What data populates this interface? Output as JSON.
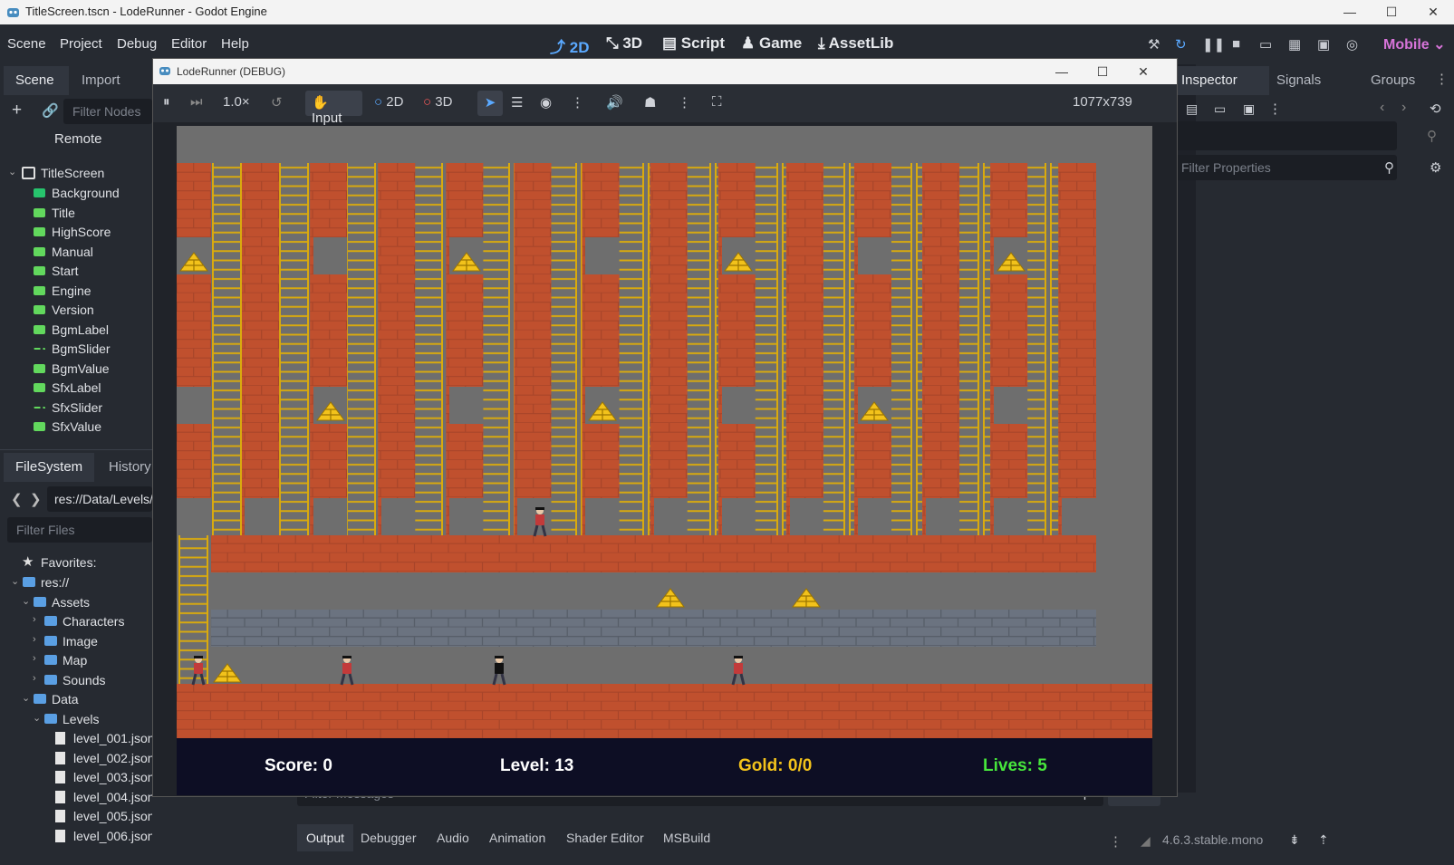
{
  "os_window": {
    "title": "TitleScreen.tscn - LodeRunner - Godot Engine",
    "minimize": "—",
    "maximize": "☐",
    "close": "✕"
  },
  "menu": [
    "Scene",
    "Project",
    "Debug",
    "Editor",
    "Help"
  ],
  "modes": [
    {
      "icon": "⤴",
      "label": "2D"
    },
    {
      "icon": "⤡",
      "label": "3D"
    },
    {
      "icon": "▤",
      "label": "Script"
    },
    {
      "icon": "♟",
      "label": "Game"
    },
    {
      "icon": "⤓",
      "label": "AssetLib"
    }
  ],
  "renderer": "Mobile ⌄",
  "scene_dock": {
    "tabs": [
      "Scene",
      "Import"
    ],
    "filter_placeholder": "Filter Nodes",
    "remote_label": "Remote",
    "root": "TitleScreen",
    "nodes": [
      {
        "name": "Background",
        "kind": "rect"
      },
      {
        "name": "Title",
        "kind": "label"
      },
      {
        "name": "HighScore",
        "kind": "label"
      },
      {
        "name": "Manual",
        "kind": "label"
      },
      {
        "name": "Start",
        "kind": "label"
      },
      {
        "name": "Engine",
        "kind": "label"
      },
      {
        "name": "Version",
        "kind": "label"
      },
      {
        "name": "BgmLabel",
        "kind": "label"
      },
      {
        "name": "BgmSlider",
        "kind": "slider"
      },
      {
        "name": "BgmValue",
        "kind": "label"
      },
      {
        "name": "SfxLabel",
        "kind": "label"
      },
      {
        "name": "SfxSlider",
        "kind": "slider"
      },
      {
        "name": "SfxValue",
        "kind": "label"
      }
    ]
  },
  "filesystem_dock": {
    "tabs": [
      "FileSystem",
      "History"
    ],
    "path": "res://Data/Levels/",
    "filter_placeholder": "Filter Files",
    "favorites": "Favorites:",
    "tree": [
      {
        "name": "res://",
        "type": "folder",
        "indent": 0,
        "open": true
      },
      {
        "name": "Assets",
        "type": "folder",
        "indent": 1,
        "open": true
      },
      {
        "name": "Characters",
        "type": "folder",
        "indent": 2,
        "open": false
      },
      {
        "name": "Image",
        "type": "folder",
        "indent": 2,
        "open": false
      },
      {
        "name": "Map",
        "type": "folder",
        "indent": 2,
        "open": false
      },
      {
        "name": "Sounds",
        "type": "folder",
        "indent": 2,
        "open": false
      },
      {
        "name": "Data",
        "type": "folder",
        "indent": 1,
        "open": true
      },
      {
        "name": "Levels",
        "type": "folder",
        "indent": 2,
        "open": true
      },
      {
        "name": "level_001.json",
        "type": "file",
        "indent": 3
      },
      {
        "name": "level_002.json",
        "type": "file",
        "indent": 3
      },
      {
        "name": "level_003.json",
        "type": "file",
        "indent": 3
      },
      {
        "name": "level_004.json",
        "type": "file",
        "indent": 3
      },
      {
        "name": "level_005.json",
        "type": "file",
        "indent": 3
      },
      {
        "name": "level_006.json",
        "type": "file",
        "indent": 3
      }
    ]
  },
  "inspector": {
    "tabs": [
      "Inspector",
      "Signals",
      "Groups"
    ],
    "filter_placeholder": "Filter Properties"
  },
  "game_window": {
    "title": "LodeRunner (DEBUG)",
    "speed": "1.0×",
    "input_label": "Input",
    "mode_2d": "2D",
    "mode_3d": "3D",
    "resolution": "1077x739"
  },
  "hud": {
    "score": "Score: 0",
    "level": "Level: 13",
    "gold": "Gold: 0/0",
    "lives": "Lives: 5"
  },
  "colors": {
    "score": "#ffffff",
    "level": "#ffffff",
    "gold": "#f2c21b",
    "lives": "#47e63c",
    "brick": "#c0502e",
    "ladder": "#d9aa0e"
  },
  "bottom_panel": {
    "filter_placeholder": "Filter Messages",
    "message_count": "0",
    "tabs": [
      "Output",
      "Debugger",
      "Audio",
      "Animation",
      "Shader Editor",
      "MSBuild"
    ],
    "version": "4.6.3.stable.mono"
  }
}
